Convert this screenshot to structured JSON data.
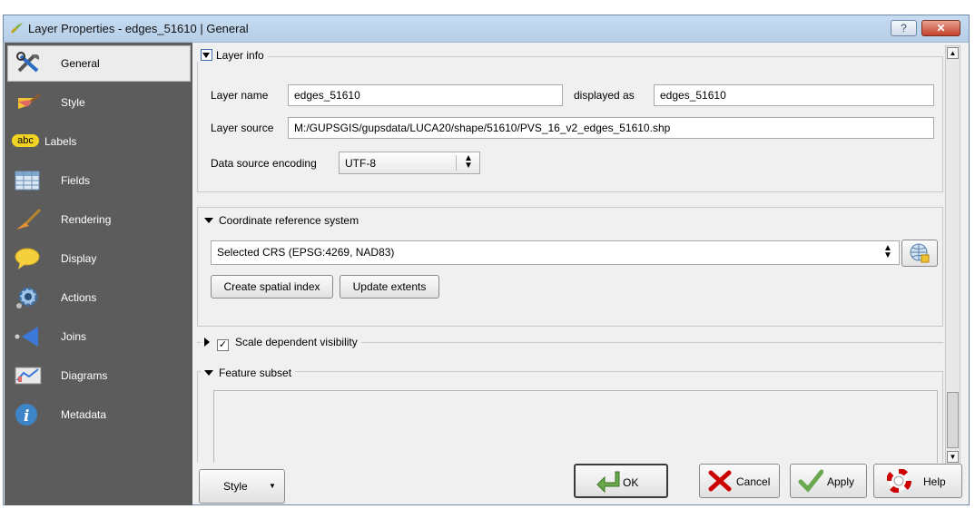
{
  "window": {
    "title": "Layer Properties - edges_51610 | General",
    "help_label": "?",
    "close_label": "✕"
  },
  "sidebar": {
    "items": [
      {
        "label": "General",
        "icon": "general-tools-icon"
      },
      {
        "label": "Style",
        "icon": "style-brush-icon"
      },
      {
        "label": "Labels",
        "icon": "labels-abc-icon"
      },
      {
        "label": "Fields",
        "icon": "fields-table-icon"
      },
      {
        "label": "Rendering",
        "icon": "rendering-brush-icon"
      },
      {
        "label": "Display",
        "icon": "display-bubble-icon"
      },
      {
        "label": "Actions",
        "icon": "actions-gear-icon"
      },
      {
        "label": "Joins",
        "icon": "joins-arrow-icon"
      },
      {
        "label": "Diagrams",
        "icon": "diagrams-icon"
      },
      {
        "label": "Metadata",
        "icon": "metadata-info-icon"
      }
    ],
    "abc_text": "abc"
  },
  "layer_info": {
    "legend": "Layer info",
    "layer_name_label": "Layer name",
    "layer_name_value": "edges_51610",
    "displayed_as_label": "displayed as",
    "displayed_as_value": "edges_51610",
    "layer_source_label": "Layer source",
    "layer_source_value": "M:/GUPSGIS/gupsdata/LUCA20/shape/51610/PVS_16_v2_edges_51610.shp",
    "encoding_label": "Data source encoding",
    "encoding_value": "UTF-8"
  },
  "crs": {
    "legend": "Coordinate reference system",
    "selected_crs": "Selected CRS (EPSG:4269, NAD83)",
    "create_index_label": "Create spatial index",
    "update_extents_label": "Update extents"
  },
  "scale_visibility": {
    "legend": "Scale dependent visibility",
    "checked": true,
    "check_mark": "✓"
  },
  "feature_subset": {
    "legend": "Feature subset"
  },
  "footer": {
    "style_label": "Style",
    "ok_label": "OK",
    "cancel_label": "Cancel",
    "apply_label": "Apply",
    "help_label": "Help"
  },
  "colors": {
    "sidebar_bg": "#5c5c5c",
    "titlebar": "#b5cee8",
    "close_button": "#c4422b"
  }
}
